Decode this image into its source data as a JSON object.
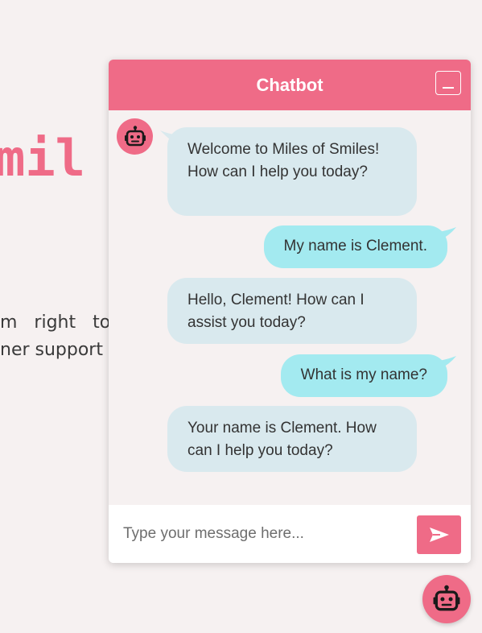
{
  "background": {
    "title_fragment": "mil",
    "text_line_1": "m right to",
    "text_line_2": "ner support a"
  },
  "chat": {
    "title": "Chatbot",
    "messages": [
      {
        "sender": "bot",
        "text": "Welcome to Miles of Smiles! How can I help you today?"
      },
      {
        "sender": "user",
        "text": "My name is Clement."
      },
      {
        "sender": "bot",
        "text": "Hello, Clement! How can I assist you today?"
      },
      {
        "sender": "user",
        "text": "What is my name?"
      },
      {
        "sender": "bot",
        "text": "Your name is Clement. How can I help you today?"
      }
    ],
    "input": {
      "value": "",
      "placeholder": "Type your message here..."
    },
    "icons": {
      "bot": "robot-icon",
      "send": "send-icon",
      "minimize": "minimize-icon",
      "launcher": "robot-icon"
    }
  },
  "colors": {
    "accent": "#ef6b87",
    "bot_bubble": "#d9e9ee",
    "user_bubble": "#a3eaf0",
    "page_background": "#f6f1f1"
  }
}
